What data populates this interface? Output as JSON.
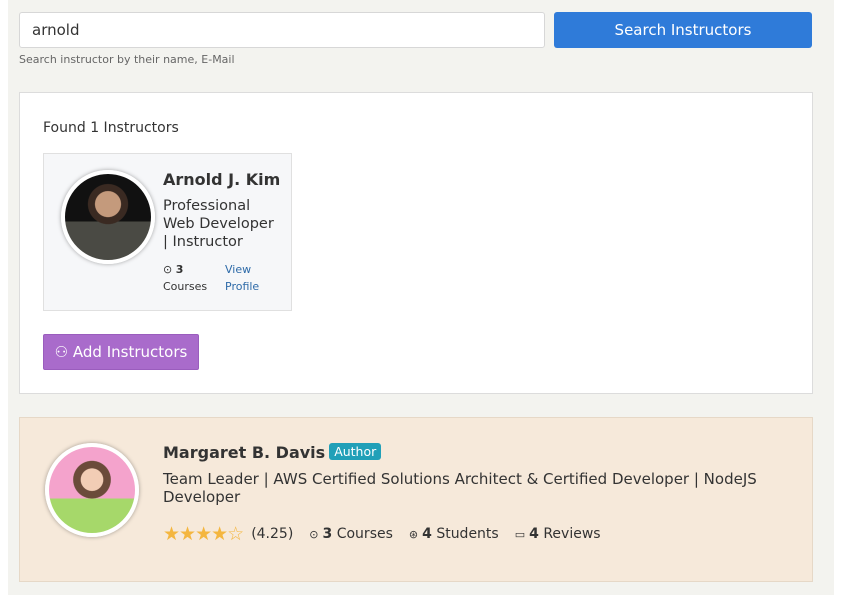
{
  "search": {
    "value": "arnold",
    "button": "Search Instructors",
    "hint": "Search instructor by their name, E-Mail"
  },
  "results": {
    "found_text": "Found 1 Instructors",
    "instructors": [
      {
        "name": "Arnold J. Kim",
        "title": "Professional Web Developer | Instructor",
        "courses_count": "3",
        "courses_label": "Courses",
        "view_profile": "View Profile"
      }
    ],
    "add_button": "Add Instructors"
  },
  "author": {
    "name": "Margaret B. Davis",
    "badge": "Author",
    "title": "Team Leader | AWS Certified Solutions Architect & Certified Developer | NodeJS Developer",
    "rating": 4.25,
    "rating_text": "(4.25)",
    "courses_count": "3",
    "courses_label": "Courses",
    "students_count": "4",
    "students_label": "Students",
    "reviews_count": "4",
    "reviews_label": "Reviews"
  },
  "colors": {
    "primary": "#2f7bd9",
    "add_button": "#a96bcb",
    "badge": "#21a0b8",
    "star": "#f4b63f"
  }
}
